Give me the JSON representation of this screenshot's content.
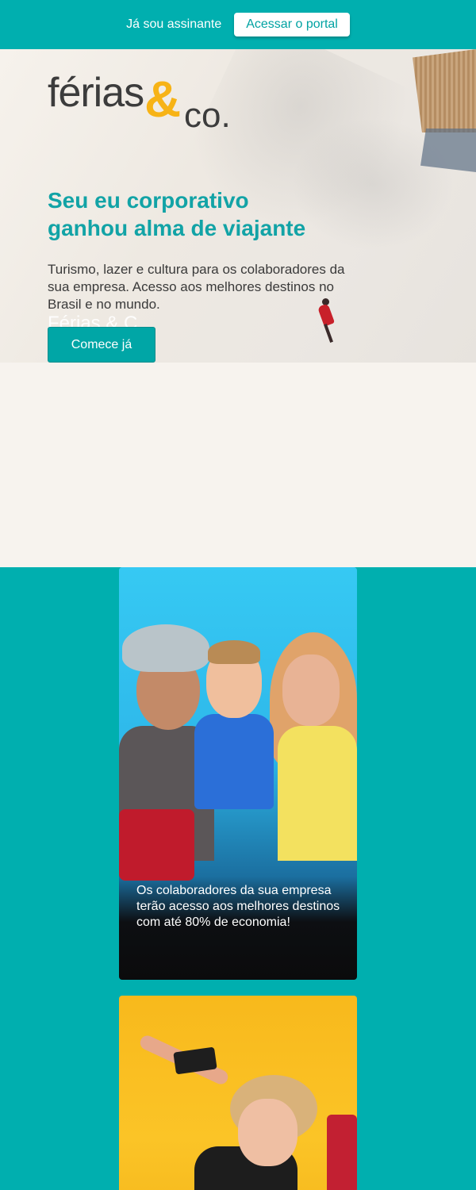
{
  "topbar": {
    "subscriber_text": "Já sou assinante",
    "portal_button": "Acessar o portal"
  },
  "hero": {
    "logo": {
      "word": "férias",
      "amp": "&",
      "co": "co."
    },
    "headline_line1": "Seu eu corporativo",
    "headline_line2": "ganhou alma de viajante",
    "subtext": "Turismo, lazer e cultura para os colaboradores da sua empresa. Acesso aos melhores destinos no Brasil e no mundo.",
    "ghost_text": "Férias & C",
    "cta_button": "Comece já"
  },
  "cards": [
    {
      "text": "Os colaboradores da sua empresa terão acesso aos melhores destinos com até 80% de economia!"
    }
  ],
  "colors": {
    "teal": "#00afaf",
    "headline_teal": "#12a3a6",
    "logo_yellow": "#f7b316",
    "beige": "#f7f3ee"
  }
}
